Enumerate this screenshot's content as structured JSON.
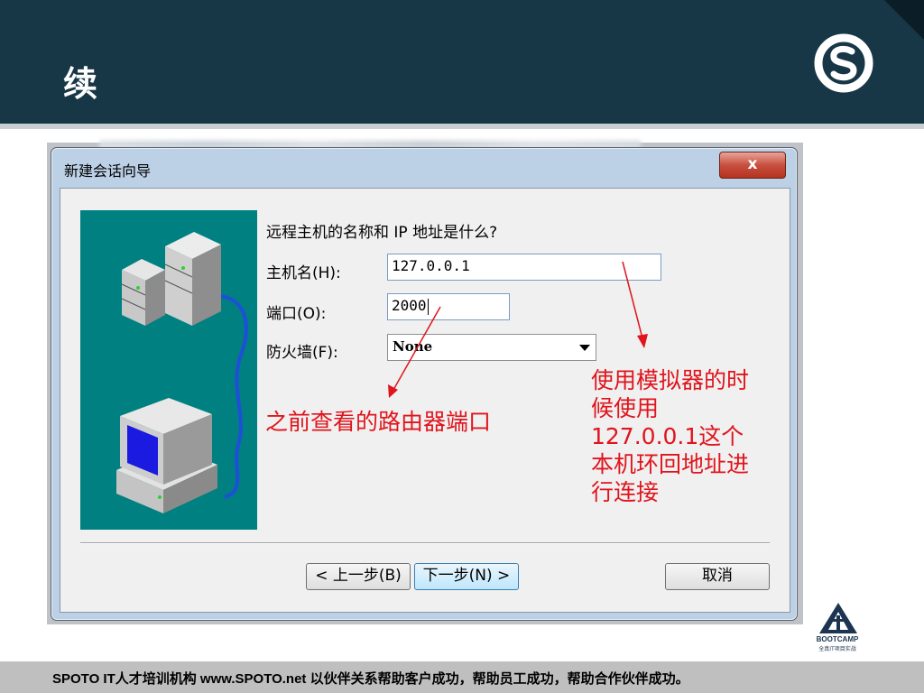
{
  "slide": {
    "title": "续",
    "footer": "SPOTO IT人才培训机构    www.SPOTO.net    以伙伴关系帮助客户成功，帮助员工成功，帮助合作伙伴成功。",
    "bootcamp_label": "BOOTCAMP",
    "bootcamp_sub": "全真IT项目实战"
  },
  "dialog": {
    "title": "新建会话向导",
    "close_label": "x",
    "question": "远程主机的名称和 IP 地址是什么?",
    "host_label": "主机名(H):",
    "host_value": "127.0.0.1",
    "port_label": "端口(O):",
    "port_value": "2000",
    "firewall_label": "防火墙(F):",
    "firewall_value": "None",
    "back_label": "< 上一步(B)",
    "next_label": "下一步(N) >",
    "cancel_label": "取消"
  },
  "annotations": {
    "port_note": "之前查看的路由器端口",
    "host_note": [
      "使用模拟器的时",
      "候使用",
      "127.0.0.1这个",
      "本机环回地址进",
      "行连接"
    ]
  },
  "colors": {
    "header": "#183746",
    "annotation": "#e0141c",
    "wizard_art_bg": "#008080",
    "footer": "#bfbfbf"
  }
}
